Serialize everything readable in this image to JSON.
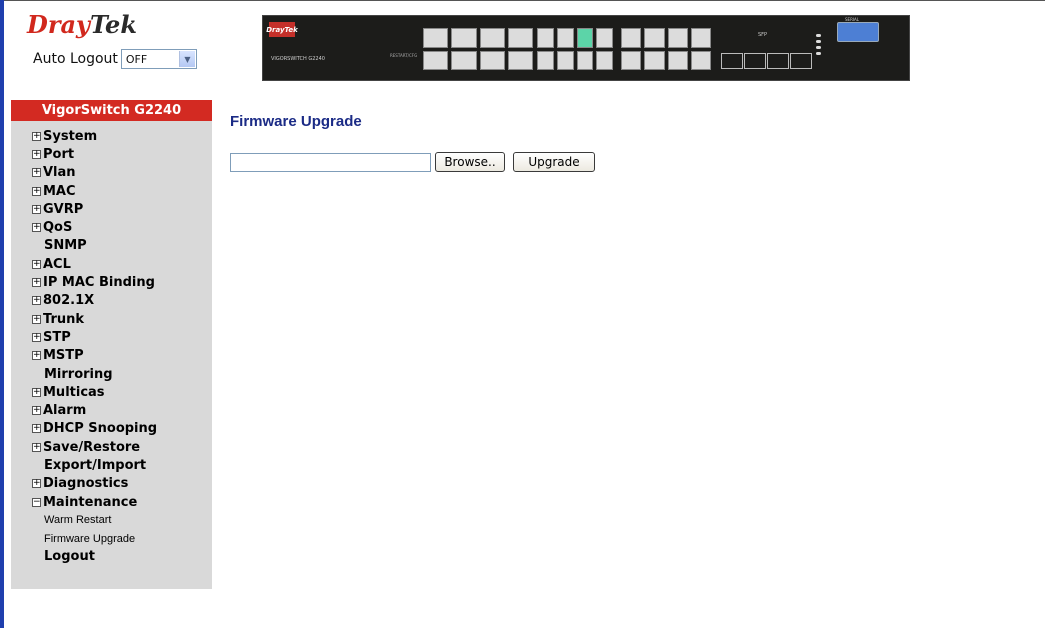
{
  "header": {
    "logo": {
      "part1": "Dray",
      "part2": "Tek"
    },
    "auto_logout": {
      "label": "Auto Logout",
      "value": "OFF"
    }
  },
  "device_image": {
    "brand": "DrayTek",
    "model": "VIGORSWITCH G2240",
    "sfp_label": "SFP",
    "serial_label": "SERIAL",
    "reset_label": "RESTART/CFG"
  },
  "sidebar": {
    "title": "VigorSwitch G2240",
    "items": [
      {
        "label": "System",
        "expand": "+"
      },
      {
        "label": "Port",
        "expand": "+"
      },
      {
        "label": "Vlan",
        "expand": "+"
      },
      {
        "label": "MAC",
        "expand": "+"
      },
      {
        "label": "GVRP",
        "expand": "+"
      },
      {
        "label": "QoS",
        "expand": "+"
      },
      {
        "label": "SNMP",
        "expand": ""
      },
      {
        "label": "ACL",
        "expand": "+"
      },
      {
        "label": "IP MAC Binding",
        "expand": "+"
      },
      {
        "label": "802.1X",
        "expand": "+"
      },
      {
        "label": "Trunk",
        "expand": "+"
      },
      {
        "label": "STP",
        "expand": "+"
      },
      {
        "label": "MSTP",
        "expand": "+"
      },
      {
        "label": "Mirroring",
        "expand": ""
      },
      {
        "label": "Multicas",
        "expand": "+"
      },
      {
        "label": "Alarm",
        "expand": "+"
      },
      {
        "label": "DHCP Snooping",
        "expand": "+"
      },
      {
        "label": "Save/Restore",
        "expand": "+"
      },
      {
        "label": "Export/Import",
        "expand": ""
      },
      {
        "label": "Diagnostics",
        "expand": "+"
      },
      {
        "label": "Maintenance",
        "expand": "−"
      },
      {
        "label": "Warm Restart",
        "expand": ""
      },
      {
        "label": "Firmware Upgrade",
        "expand": ""
      },
      {
        "label": "Logout",
        "expand": ""
      }
    ]
  },
  "main": {
    "title": "Firmware Upgrade",
    "file_value": "",
    "browse_label": "Browse..",
    "upgrade_label": "Upgrade"
  },
  "colors": {
    "accent": "#d32a22",
    "title": "#1b2b86",
    "sidebar_bg": "#d9d9d9",
    "left_edge": "#1f3fae"
  }
}
